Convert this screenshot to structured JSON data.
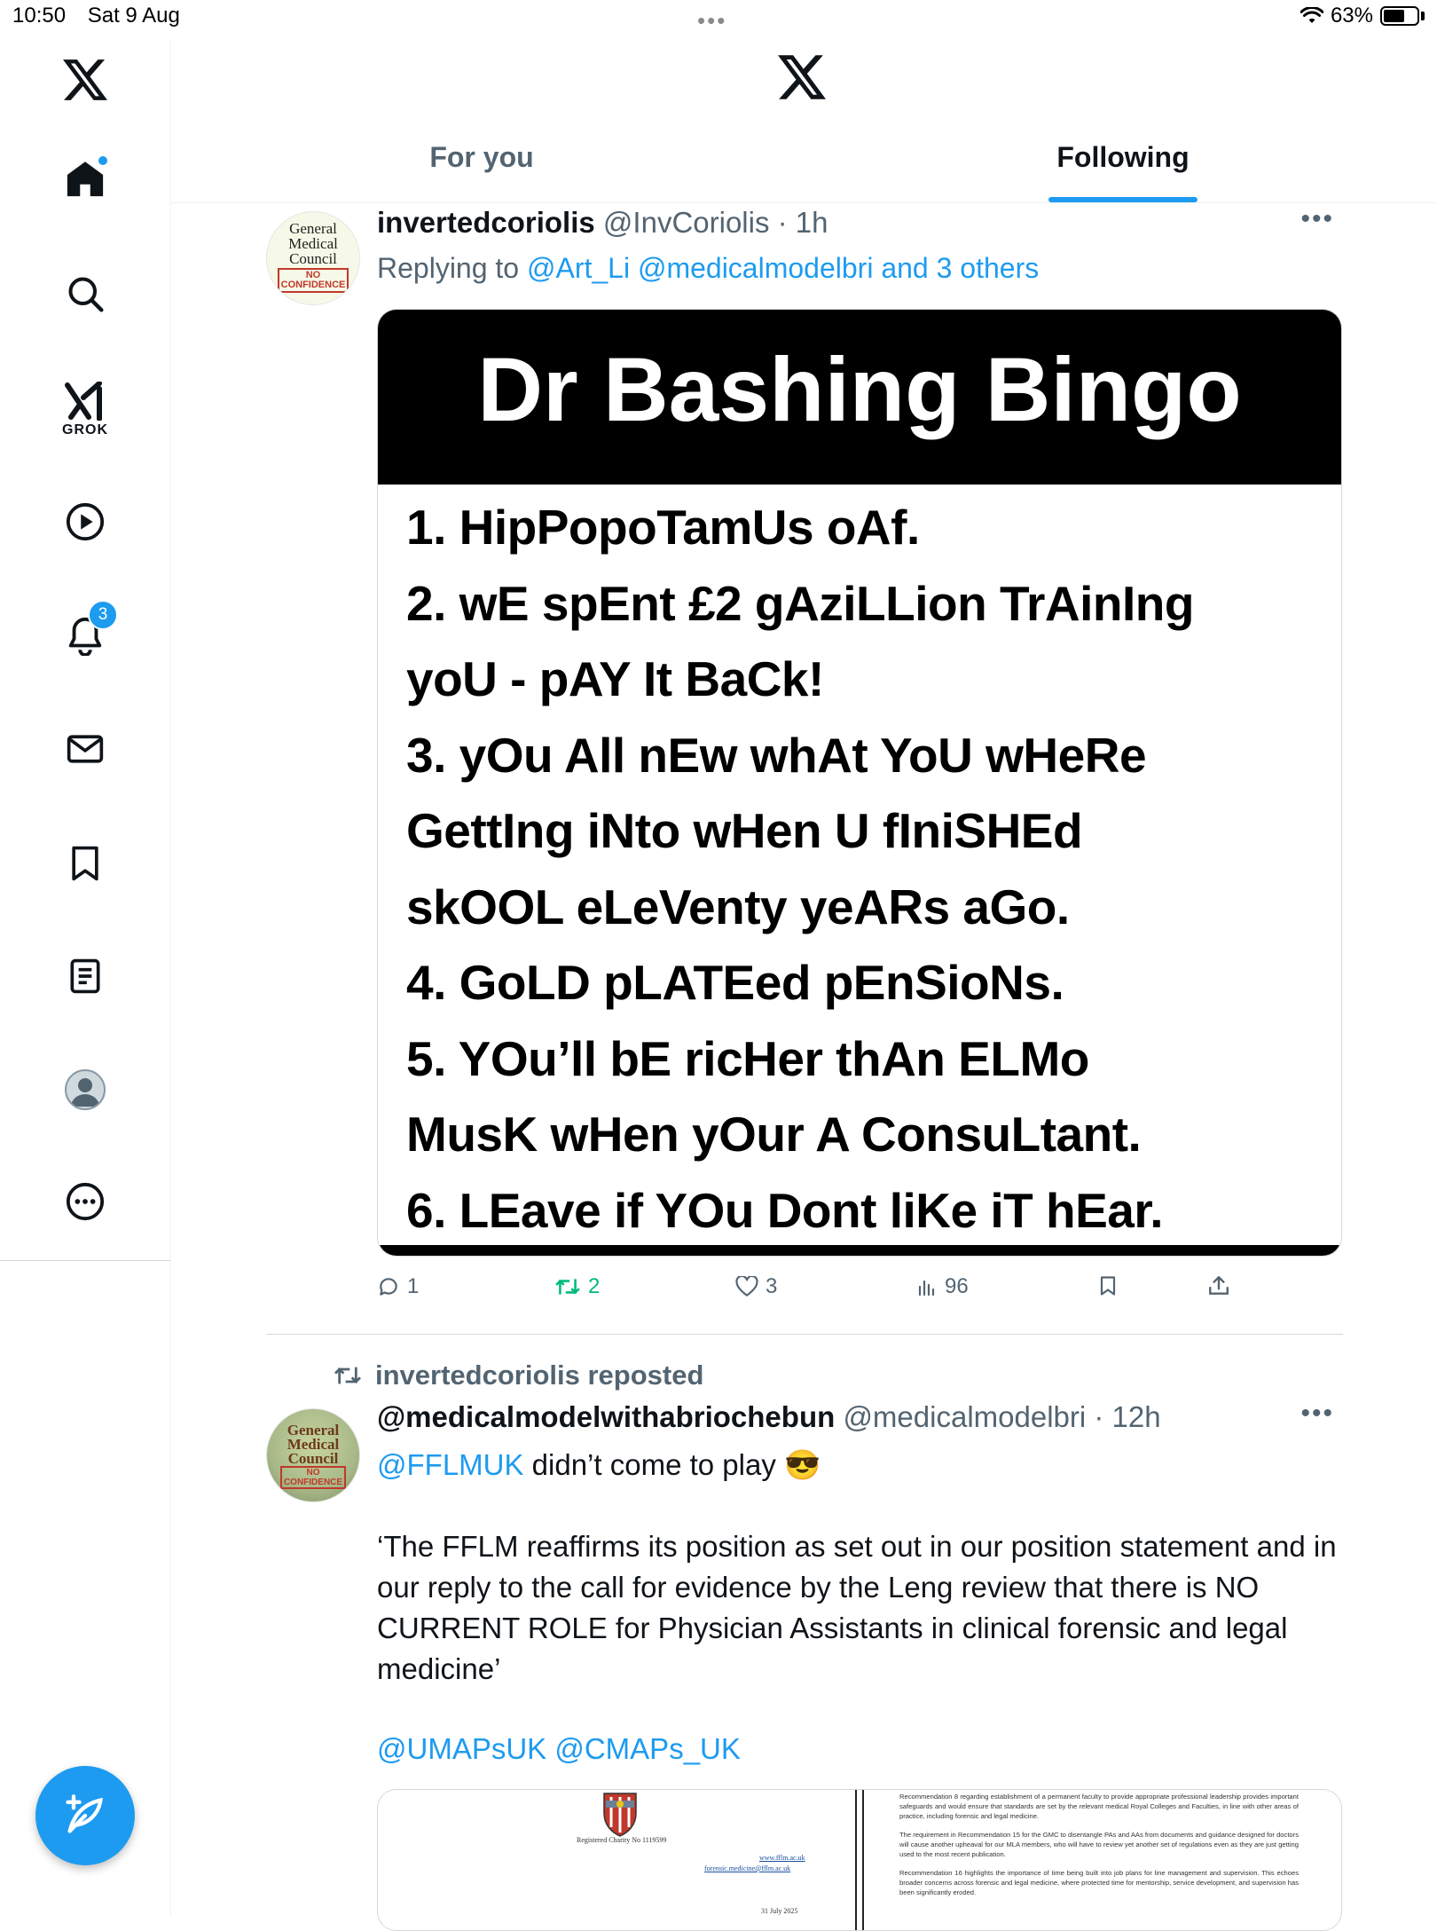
{
  "status_bar": {
    "time": "10:50",
    "date": "Sat 9 Aug",
    "battery": "63%",
    "battery_level": 0.63
  },
  "nav": {
    "grok_label": "GROK",
    "notifications_count": "3",
    "icons": [
      "x-logo-icon",
      "home-icon",
      "search-icon",
      "grok-icon",
      "video-icon",
      "bell-icon",
      "mail-icon",
      "bookmark-icon",
      "list-icon",
      "profile-icon",
      "more-circle-icon",
      "compose-icon"
    ]
  },
  "header": {
    "tabs": [
      {
        "label": "For you",
        "active": false
      },
      {
        "label": "Following",
        "active": true
      }
    ]
  },
  "tweet1": {
    "name": "invertedcoriolis",
    "handle": "@InvCoriolis",
    "time": "· 1h",
    "replying_prefix": "Replying to ",
    "replying_to": "@Art_Li @medicalmodelbri and 3 others",
    "avatar": {
      "l1": "General",
      "l2": "Medical",
      "l3": "Council",
      "stamp1": "NO",
      "stamp2": "CONFIDENCE"
    },
    "image": {
      "title": "Dr Bashing Bingo",
      "lines": [
        "1. HipPopoTamUs oAf.",
        "2. wE spEnt £2 gAziLLion TrAinIng",
        "yoU - pAY It BaCk!",
        "3. yOu All nEw whAt YoU wHeRe",
        "GettIng iNto wHen U fIniSHEd",
        "skOOL eLeVenty yeARs aGo.",
        "4. GoLD pLATEed pEnSioNs.",
        "5. YOu’ll bE ricHer thAn ELMo",
        "MusK wHen yOur A ConsuLtant.",
        "6. LEave if YOu Dont liKe iT hEar."
      ]
    },
    "actions": {
      "replies": "1",
      "reposts": "2",
      "likes": "3",
      "views": "96"
    }
  },
  "tweet2": {
    "repost_label": "invertedcoriolis reposted",
    "name": "@medicalmodelwithabriochebun",
    "handle": "@medicalmodelbri",
    "time": "· 12h",
    "avatar": {
      "l1": "General",
      "l2": "Medical",
      "l3": "Council",
      "stamp1": "NO",
      "stamp2": "CONFIDENCE"
    },
    "mention": "@FFLMUK",
    "text1": " didn’t come to play 😎",
    "text2": "‘The FFLM reaffirms its position as set out in our position statement and in our reply to the call for evidence by the Leng review that there is NO CURRENT ROLE for Physician Assistants in clinical forensic and legal medicine’",
    "mentions_line": "@UMAPsUK @CMAPs_UK",
    "doc_left": {
      "charity": "Registered Charity No 1119599",
      "web": "www.fflm.ac.uk",
      "email": "forensic.medicine@fflm.ac.uk",
      "date": "31 July 2025"
    },
    "doc_right": {
      "p1": "Recommendation 8 regarding establishment of a permanent faculty to provide appropriate professional leadership provides important safeguards and would ensure that standards are set by the relevant medical Royal Colleges and Faculties, in line with other areas of practice, including forensic and legal medicine.",
      "p2": "The requirement in Recommendation 15 for the GMC to disentangle PAs and AAs from documents and guidance designed for doctors will cause another upheaval for our MLA members, who will have to review yet another set of regulations even as they are just getting used to the most recent publication.",
      "p3": "Recommendation 16 highlights the importance of time being built into job plans for line management and supervision. This echoes broader concerns across forensic and legal medicine, where protected time for mentorship, service development, and supervision has been significantly eroded."
    }
  },
  "colors": {
    "accent": "#1d9bf0",
    "retweet_green": "#00ba7c",
    "text_secondary": "#536471",
    "divider": "#cfd9de"
  }
}
